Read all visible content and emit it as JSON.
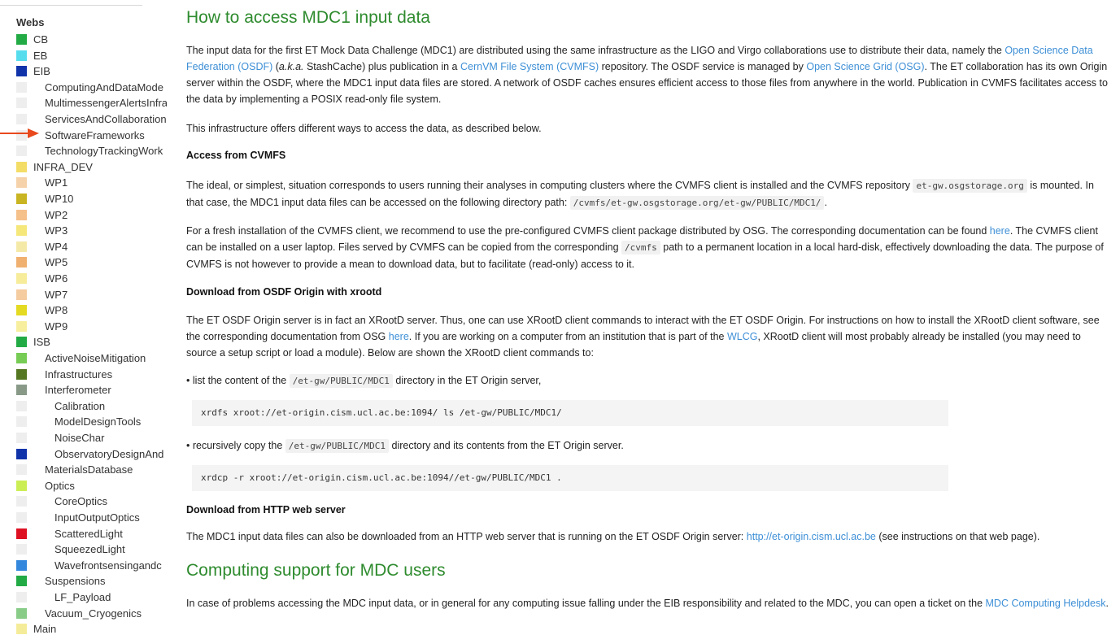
{
  "sidebar": {
    "title": "Webs",
    "items": [
      {
        "label": "CB",
        "color": "#22aa44",
        "indent": 0
      },
      {
        "label": "EB",
        "color": "#55ddee",
        "indent": 0
      },
      {
        "label": "EIB",
        "color": "#1133aa",
        "indent": 0
      },
      {
        "label": "ComputingAndDataMode",
        "color": "#eeeeee",
        "indent": 1
      },
      {
        "label": "MultimessengerAlertsInfra",
        "color": "#eeeeee",
        "indent": 1
      },
      {
        "label": "ServicesAndCollaboration",
        "color": "#eeeeee",
        "indent": 1
      },
      {
        "label": "SoftwareFrameworks",
        "color": "#eeeeee",
        "indent": 1
      },
      {
        "label": "TechnologyTrackingWork",
        "color": "#eeeeee",
        "indent": 1
      },
      {
        "label": "INFRA_DEV",
        "color": "#f3dd66",
        "indent": 0
      },
      {
        "label": "WP1",
        "color": "#f5d2aa",
        "indent": 1
      },
      {
        "label": "WP10",
        "color": "#c9b422",
        "indent": 1
      },
      {
        "label": "WP2",
        "color": "#f5c08a",
        "indent": 1
      },
      {
        "label": "WP3",
        "color": "#f5e77a",
        "indent": 1
      },
      {
        "label": "WP4",
        "color": "#f5e9a8",
        "indent": 1
      },
      {
        "label": "WP5",
        "color": "#f0b070",
        "indent": 1
      },
      {
        "label": "WP6",
        "color": "#f6ec9a",
        "indent": 1
      },
      {
        "label": "WP7",
        "color": "#f5cba0",
        "indent": 1
      },
      {
        "label": "WP8",
        "color": "#e4da22",
        "indent": 1
      },
      {
        "label": "WP9",
        "color": "#f7ef9e",
        "indent": 1
      },
      {
        "label": "ISB",
        "color": "#22aa44",
        "indent": 0
      },
      {
        "label": "ActiveNoiseMitigation",
        "color": "#77cc55",
        "indent": 1
      },
      {
        "label": "Infrastructures",
        "color": "#557722",
        "indent": 1
      },
      {
        "label": "Interferometer",
        "color": "#889988",
        "indent": 1
      },
      {
        "label": "Calibration",
        "color": "#eeeeee",
        "indent": 2
      },
      {
        "label": "ModelDesignTools",
        "color": "#eeeeee",
        "indent": 2
      },
      {
        "label": "NoiseChar",
        "color": "#eeeeee",
        "indent": 2
      },
      {
        "label": "ObservatoryDesignAnd",
        "color": "#1133aa",
        "indent": 2
      },
      {
        "label": "MaterialsDatabase",
        "color": "#eeeeee",
        "indent": 1
      },
      {
        "label": "Optics",
        "color": "#ccee55",
        "indent": 1
      },
      {
        "label": "CoreOptics",
        "color": "#eeeeee",
        "indent": 2
      },
      {
        "label": "InputOutputOptics",
        "color": "#eeeeee",
        "indent": 2
      },
      {
        "label": "ScatteredLight",
        "color": "#dd1122",
        "indent": 2
      },
      {
        "label": "SqueezedLight",
        "color": "#eeeeee",
        "indent": 2
      },
      {
        "label": "Wavefrontsensingandc",
        "color": "#3388dd",
        "indent": 2
      },
      {
        "label": "Suspensions",
        "color": "#22aa44",
        "indent": 1
      },
      {
        "label": "LF_Payload",
        "color": "#eeeeee",
        "indent": 2
      },
      {
        "label": "Vacuum_Cryogenics",
        "color": "#88cc88",
        "indent": 1
      },
      {
        "label": "Main",
        "color": "#f5ec9a",
        "indent": 0
      }
    ]
  },
  "content": {
    "h1": "How to access MDC1 input data",
    "p1": {
      "t1": "The input data for the first ET Mock Data Challenge (MDC1) are distributed using the same infrastructure as the LIGO and Virgo collaborations use to distribute their data, namely the ",
      "l1": "Open Science Data Federation (OSDF)",
      "t2": " (",
      "em": "a.k.a.",
      "t3": " StashCache) plus publication in a ",
      "l2": "CernVM File System (CVMFS)",
      "t4": " repository. The OSDF service is managed by ",
      "l3": "Open Science Grid (OSG)",
      "t5": ". The ET collaboration has its own Origin server within the OSDF, where the MDC1 input data files are stored. A network of OSDF caches ensures efficient access to those files from anywhere in the world. Publication in CVMFS facilitates access to the data by implementing a POSIX read-only file system."
    },
    "p2": "This infrastructure offers different ways to access the data, as described below.",
    "h3_cvmfs": "Access from CVMFS",
    "p3": {
      "t1": "The ideal, or simplest, situation corresponds to users running their analyses in computing clusters where the CVMFS client is installed and the CVMFS repository ",
      "c1": "et-gw.osgstorage.org",
      "t2": " is mounted. In that case, the MDC1 input data files can be accessed on the following directory path: ",
      "c2": "/cvmfs/et-gw.osgstorage.org/et-gw/PUBLIC/MDC1/",
      "t3": "."
    },
    "p4": {
      "t1": "For a fresh installation of the CVMFS client, we recommend to use the pre-configured CVMFS client package distributed by OSG. The corresponding documentation can be found ",
      "l1": "here",
      "t2": ". The CVMFS client can be installed on a user laptop. Files served by CVMFS can be copied from the corresponding ",
      "c1": "/cvmfs",
      "t3": " path to a permanent location in a local hard-disk, effectively downloading the data. The purpose of CVMFS is not however to provide a mean to download data, but to facilitate (read-only) access to it."
    },
    "h3_xrootd": "Download from OSDF Origin with xrootd",
    "p5": {
      "t1": "The ET OSDF Origin server is in fact an XRootD server. Thus, one can use XRootD client commands to interact with the ET OSDF Origin. For instructions on how to install the XRootD client software, see the corresponding documentation from OSG ",
      "l1": "here",
      "t2": ". If you are working on a computer from an institution that is part of the ",
      "l2": "WLCG",
      "t3": ", XRootD client will most probably already be installed (you may need to source a setup script or load a module). Below are shown the XRootD client commands to:"
    },
    "b1": {
      "t1": "• list the content of the ",
      "c1": "/et-gw/PUBLIC/MDC1",
      "t2": " directory in the ET Origin server,"
    },
    "pre1": "xrdfs xroot://et-origin.cism.ucl.ac.be:1094/ ls /et-gw/PUBLIC/MDC1/",
    "b2": {
      "t1": "• recursively copy the ",
      "c1": "/et-gw/PUBLIC/MDC1",
      "t2": " directory and its contents from the ET Origin server."
    },
    "pre2": "xrdcp -r xroot://et-origin.cism.ucl.ac.be:1094//et-gw/PUBLIC/MDC1 .",
    "h3_http": "Download from HTTP web server",
    "p6": {
      "t1": "The MDC1 input data files can also be downloaded from an HTTP web server that is running on the ET OSDF Origin server: ",
      "l1": "http://et-origin.cism.ucl.ac.be",
      "t2": " (see instructions on that web page)."
    },
    "h2": "Computing support for MDC users",
    "p7": {
      "t1": "In case of problems accessing the MDC input data, or in general for any computing issue falling under the EIB responsibility and related to the MDC, you can open a ticket on the ",
      "l1": "MDC Computing Helpdesk",
      "t2": "."
    }
  },
  "colors": {
    "heading": "#2e8b2e",
    "link": "#3d8fd6",
    "arrow": "#e8491d"
  }
}
